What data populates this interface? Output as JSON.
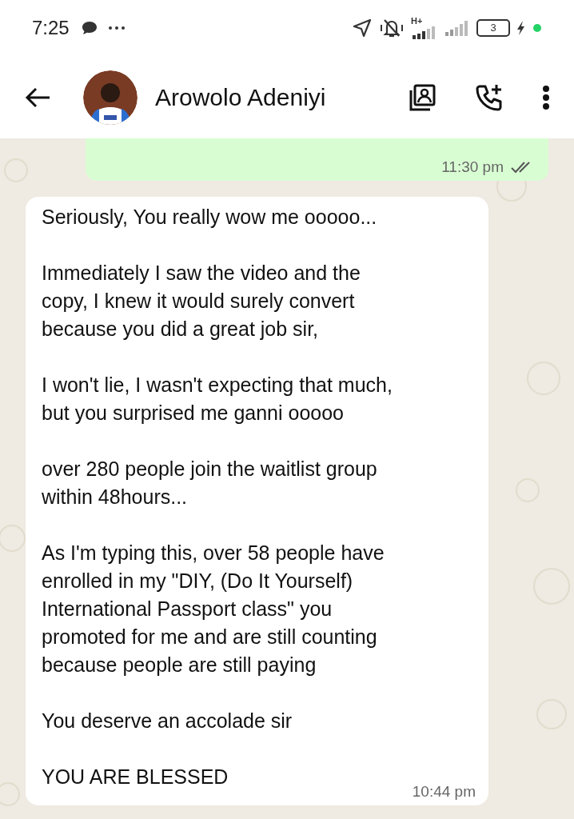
{
  "status_bar": {
    "time": "7:25",
    "network": "H+",
    "battery": "3"
  },
  "header": {
    "contact_name": "Arowolo Adeniyi"
  },
  "messages": [
    {
      "kind": "outgoing",
      "time": "11:30 pm"
    },
    {
      "kind": "incoming",
      "paragraphs": [
        "Seriously, You really wow me ooooo...",
        "Immediately I saw the video and the\ncopy, I knew it would surely convert\nbecause you did a great job sir,",
        "I won't lie, I wasn't expecting that much,\nbut you surprised me ganni ooooo",
        "over 280 people join the waitlist group\nwithin 48hours...",
        "As I'm typing this, over 58 people have\nenrolled in my \"DIY, (Do It Yourself)\nInternational Passport class\" you\npromoted for me and are still counting\nbecause people are still paying",
        "You deserve an accolade sir",
        "YOU ARE BLESSED"
      ],
      "time": "10:44 pm"
    }
  ]
}
